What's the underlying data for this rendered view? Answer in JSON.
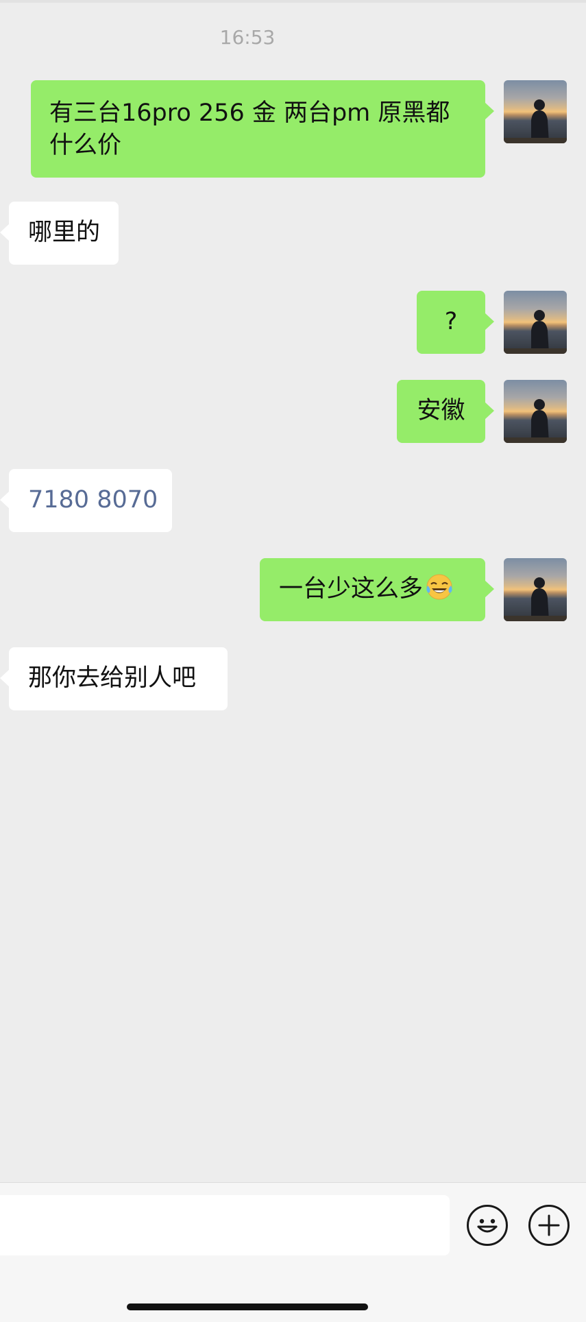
{
  "chat": {
    "timestamp": "16:53",
    "messages": [
      {
        "side": "right",
        "text": "有三台16pro 256 金 两台pm 原黑都什么价"
      },
      {
        "side": "left",
        "text": "哪里的"
      },
      {
        "side": "right",
        "text": "?"
      },
      {
        "side": "right",
        "text": "安徽"
      },
      {
        "side": "left",
        "text": "7180 8070"
      },
      {
        "side": "right",
        "text": "一台少这么多",
        "emoji": "face-with-tears-of-joy-emoji"
      },
      {
        "side": "left",
        "text": "那你去给别人吧"
      }
    ]
  },
  "input_bar": {
    "icons": [
      "emoji-button-icon",
      "plus-button-icon"
    ]
  },
  "colors": {
    "background": "#ededed",
    "bubble_sent": "#95ec69",
    "bubble_received": "#ffffff",
    "link_text": "#576b95",
    "timestamp": "#a8a8a8"
  }
}
